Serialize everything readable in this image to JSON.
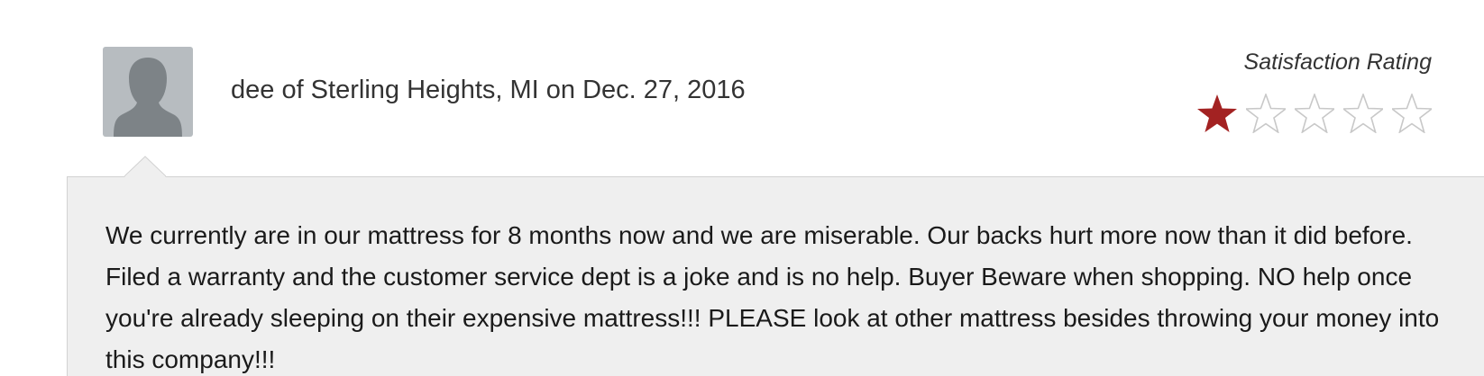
{
  "review": {
    "author_line": "dee of Sterling Heights, MI on Dec. 27, 2016",
    "rating_label": "Satisfaction Rating",
    "rating": 1,
    "rating_max": 5,
    "body": "We currently are in our mattress for 8 months now and we are miserable. Our backs hurt more now than it did before. Filed a warranty and the customer service dept is a joke and is no help. Buyer Beware when shopping. NO help once you're already sleeping on their expensive mattress!!! PLEASE look at other mattress besides throwing your money into this company!!!"
  },
  "colors": {
    "star_filled": "#a32222",
    "star_empty": "#c8c8c8",
    "bubble_background": "#efefef",
    "avatar_background": "#b7bcc0",
    "avatar_figure": "#7d8387"
  },
  "icons": {
    "avatar": "default-user-silhouette-icon",
    "star_filled": "filled-star-icon",
    "star_empty": "empty-star-icon"
  }
}
